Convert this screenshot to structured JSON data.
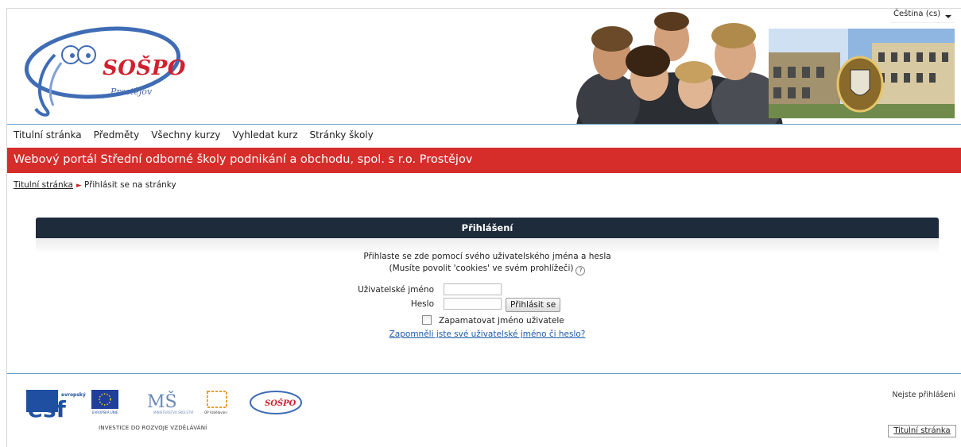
{
  "header": {
    "logo_name": "SOŠPO",
    "logo_city": "Prostějov",
    "language": "Čeština (cs)"
  },
  "nav": {
    "items": [
      "Titulní stránka",
      "Předměty",
      "Všechny kurzy",
      "Vyhledat kurz",
      "Stránky školy"
    ]
  },
  "banner": {
    "title": "Webový portál Střední odborné školy podnikání a obchodu, spol. s r.o. Prostějov"
  },
  "breadcrumb": {
    "home": "Titulní stránka",
    "current": "Přihlásit se na stránky"
  },
  "login": {
    "title": "Přihlášení",
    "intro_line1": "Přihlaste se zde pomocí svého uživatelského jména a hesla",
    "intro_line2": "(Musíte povolit 'cookies' ve svém prohlížeči)",
    "username_label": "Uživatelské jméno",
    "username_value": "",
    "password_label": "Heslo",
    "password_value": "",
    "submit_label": "Přihlásit se",
    "remember_label": "Zapamatovat jméno uživatele",
    "forgot_label": "Zapomněli jste své uživatelské jméno či heslo?"
  },
  "footer": {
    "esf_label": "evropský sociální fond v ČR",
    "eu_label": "EVROPSKÁ UNIE",
    "msmt_label": "MINISTERSTVO ŠKOLSTVÍ, MLÁDEŽE A TĚLOVÝCHOVY",
    "op_label": "OP Vzdělávání pro konkurenceschopnost",
    "invest_text": "INVESTICE DO ROZVOJE VZDĚLÁVÁNÍ",
    "not_logged": "Nejste přihlášeni",
    "home_button": "Titulní stránka"
  },
  "colors": {
    "banner": "#d62d2b",
    "login_header": "#1d2b3a",
    "link": "#1d5aa8",
    "accent_line": "#6aa0c8"
  }
}
